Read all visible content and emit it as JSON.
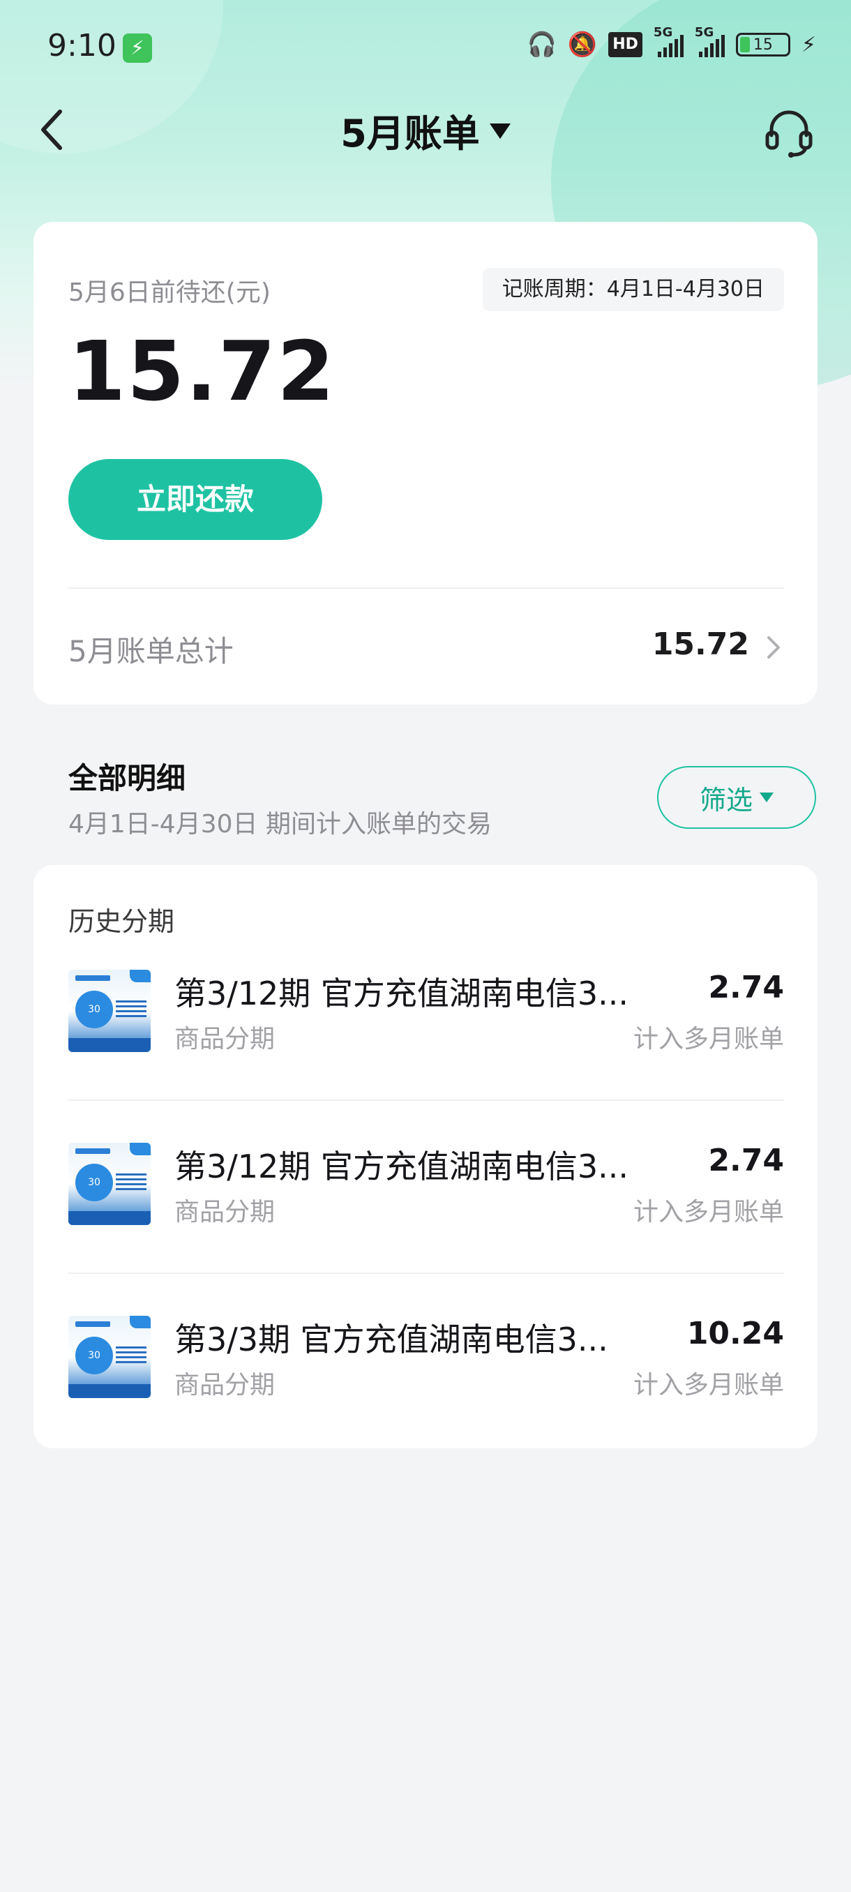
{
  "status_bar": {
    "time": "9:10",
    "battery_level": "15",
    "network_1": "5G",
    "network_2": "5G",
    "hd_label": "HD"
  },
  "header": {
    "title": "5月账单"
  },
  "summary": {
    "due_label": "5月6日前待还(元)",
    "billing_cycle": "记账周期：4月1日-4月30日",
    "amount": "15.72",
    "pay_button": "立即还款",
    "total_label": "5月账单总计",
    "total_value": "15.72"
  },
  "details": {
    "title": "全部明细",
    "subtitle": "4月1日-4月30日 期间计入账单的交易",
    "filter_label": "筛选"
  },
  "history": {
    "heading": "历史分期",
    "items": [
      {
        "title": "第3/12期 官方充值湖南电信3...",
        "amount": "2.74",
        "type": "商品分期",
        "note": "计入多月账单",
        "thumb_text": "30"
      },
      {
        "title": "第3/12期 官方充值湖南电信3...",
        "amount": "2.74",
        "type": "商品分期",
        "note": "计入多月账单",
        "thumb_text": "30"
      },
      {
        "title": "第3/3期 官方充值湖南电信3...",
        "amount": "10.24",
        "type": "商品分期",
        "note": "计入多月账单",
        "thumb_text": "30"
      }
    ]
  },
  "colors": {
    "accent": "#1ec2a3",
    "header_bg": "#b2ecdd",
    "page_bg": "#f3f4f6"
  },
  "icons": {
    "back": "chevron-left-icon",
    "support": "headset-icon",
    "title_dropdown": "caret-down-icon",
    "total_arrow": "chevron-right-icon"
  }
}
